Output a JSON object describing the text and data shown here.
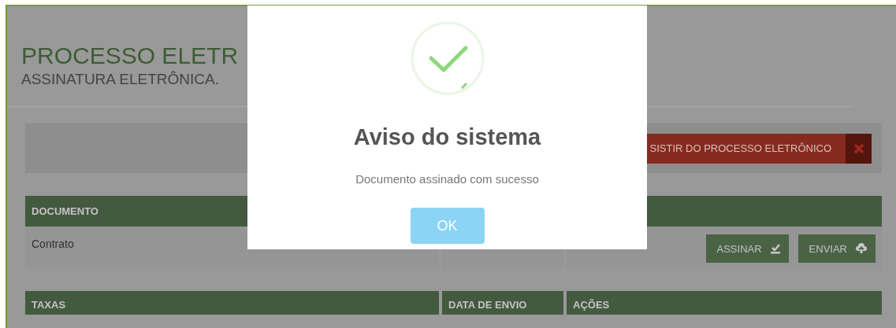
{
  "page": {
    "title": "PROCESSO ELETR",
    "subtitle": "ASSINATURA ELETRÔNICA."
  },
  "toolbar": {
    "withdraw_button": "SISTIR DO PROCESSO ELETRÔNICO"
  },
  "documents_table": {
    "columns": [
      "DOCUMENTO"
    ],
    "rows": [
      {
        "document": "Contrato",
        "actions": [
          {
            "label": "ASSINAR",
            "kind": "sign"
          },
          {
            "label": "ENVIAR",
            "kind": "upload"
          }
        ]
      }
    ]
  },
  "fees_table": {
    "columns": [
      "TAXAS",
      "DATA DE ENVIO",
      "AÇÕES"
    ]
  },
  "dialog": {
    "title": "Aviso do sistema",
    "message": "Documento assinado com sucesso",
    "button": "OK"
  }
}
